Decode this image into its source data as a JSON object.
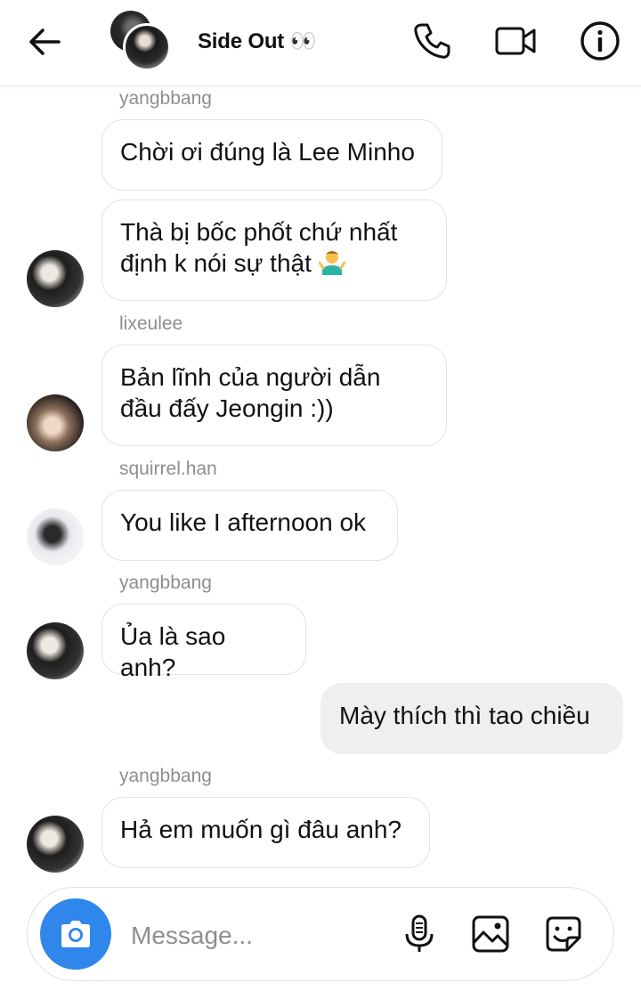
{
  "header": {
    "title": "Side Out 👀",
    "back_icon": "arrow-left-icon",
    "call_icon": "phone-icon",
    "video_icon": "video-camera-icon",
    "info_icon": "info-icon"
  },
  "messages": [
    {
      "sender": "yangbbang",
      "bubbles": [
        "Chời ơi đúng là Lee Minho",
        "Thà bị bốc phốt chứ nhất định k nói sự thật 🤷‍♂️"
      ]
    },
    {
      "sender": "lixeulee",
      "bubbles": [
        "Bản lĩnh của người dẫn đầu đấy Jeongin :))"
      ]
    },
    {
      "sender": "squirrel.han",
      "bubbles": [
        "You like I afternoon ok"
      ]
    },
    {
      "sender": "yangbbang",
      "bubbles": [
        "Ủa là sao anh?"
      ]
    },
    {
      "sender": "me",
      "bubbles": [
        "Mày thích thì tao chiều"
      ]
    },
    {
      "sender": "yangbbang",
      "bubbles": [
        "Hả em muốn gì đâu anh?"
      ]
    }
  ],
  "text": {
    "s1": "yangbbang",
    "b1": "Chời ơi đúng là Lee Minho",
    "b2a": "Thà bị bốc phốt chứ nhất",
    "b2b": "định k nói sự thật",
    "s2": "lixeulee",
    "b3a": "Bản lĩnh của người dẫn",
    "b3b": "đầu đấy Jeongin :))",
    "s3": "squirrel.han",
    "b4": "You like I afternoon ok",
    "s4": "yangbbang",
    "b5": "Ủa là sao anh?",
    "b6": "Mày thích thì tao chiều",
    "s5": "yangbbang",
    "b7": "Hả em muốn gì đâu anh?"
  },
  "composer": {
    "placeholder": "Message...",
    "camera_icon": "camera-icon",
    "mic_icon": "microphone-icon",
    "gallery_icon": "image-icon",
    "sticker_icon": "sticker-icon"
  },
  "colors": {
    "accent": "#2f86eb",
    "outgoing_bubble": "#efefef",
    "sender_label": "#8e8e8e"
  }
}
